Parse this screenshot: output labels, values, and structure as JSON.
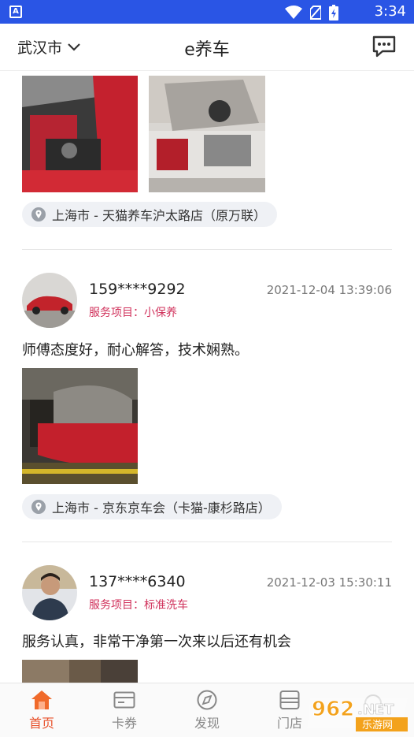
{
  "status_bar": {
    "app_badge": "A",
    "time": "3:34"
  },
  "header": {
    "city": "武汉市",
    "title": "e养车"
  },
  "feed": {
    "posts": [
      {
        "location": "上海市 - 天猫养车沪太路店（原万联）"
      },
      {
        "user": "159****9292",
        "date": "2021-12-04 13:39:06",
        "service": "服务项目：小保养",
        "comment": "师傅态度好，耐心解答，技术娴熟。",
        "location": "上海市 - 京东京车会（卡猫-康杉路店）"
      },
      {
        "user": "137****6340",
        "date": "2021-12-03 15:30:11",
        "service": "服务项目：标准洗车",
        "comment": "服务认真，非常干净第一次来以后还有机会"
      }
    ]
  },
  "tabbar": {
    "tabs": [
      {
        "label": "首页",
        "icon": "home-icon",
        "active": true
      },
      {
        "label": "卡券",
        "icon": "card-icon",
        "active": false
      },
      {
        "label": "发现",
        "icon": "compass-icon",
        "active": false
      },
      {
        "label": "门店",
        "icon": "store-icon",
        "active": false
      }
    ]
  },
  "watermark": {
    "brand": "962.NET",
    "sub": "乐游网"
  },
  "colors": {
    "status_bar": "#2a55e5",
    "accent": "#e8502a",
    "service_text": "#d0315b",
    "chip_bg": "#eff1f5"
  }
}
